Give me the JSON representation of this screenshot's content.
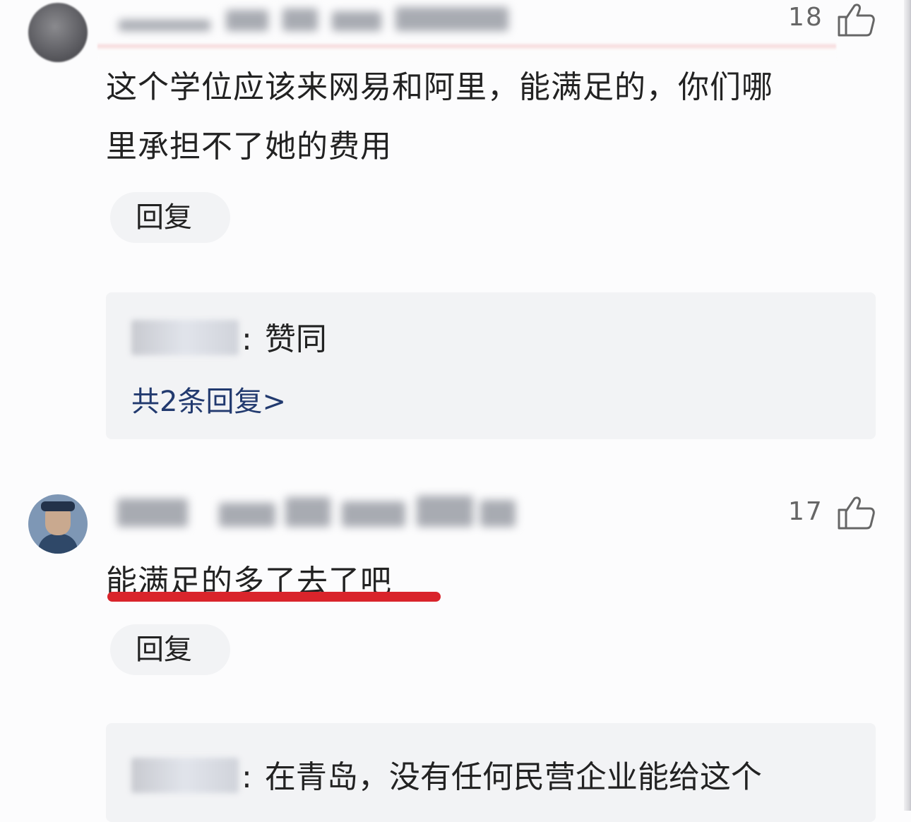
{
  "comments": [
    {
      "like_count": "18",
      "text_line1": "这个学位应该来网易和阿里，能满足的，你们哪",
      "text_line2": "里承担不了她的费用",
      "reply_label": "回复",
      "sub_reply": {
        "text": "赞同",
        "more_label": "共2条回复>"
      }
    },
    {
      "like_count": "17",
      "text_line1": "能满足的多了去了吧",
      "reply_label": "回复",
      "sub_reply": {
        "text": "在青岛，没有任何民营企业能给这个"
      }
    }
  ],
  "colors": {
    "highlight_underline": "#d9242b",
    "link_blue": "#223a6f",
    "reply_bg": "#f2f3f5"
  },
  "icons": [
    "thumbs-up-icon"
  ]
}
